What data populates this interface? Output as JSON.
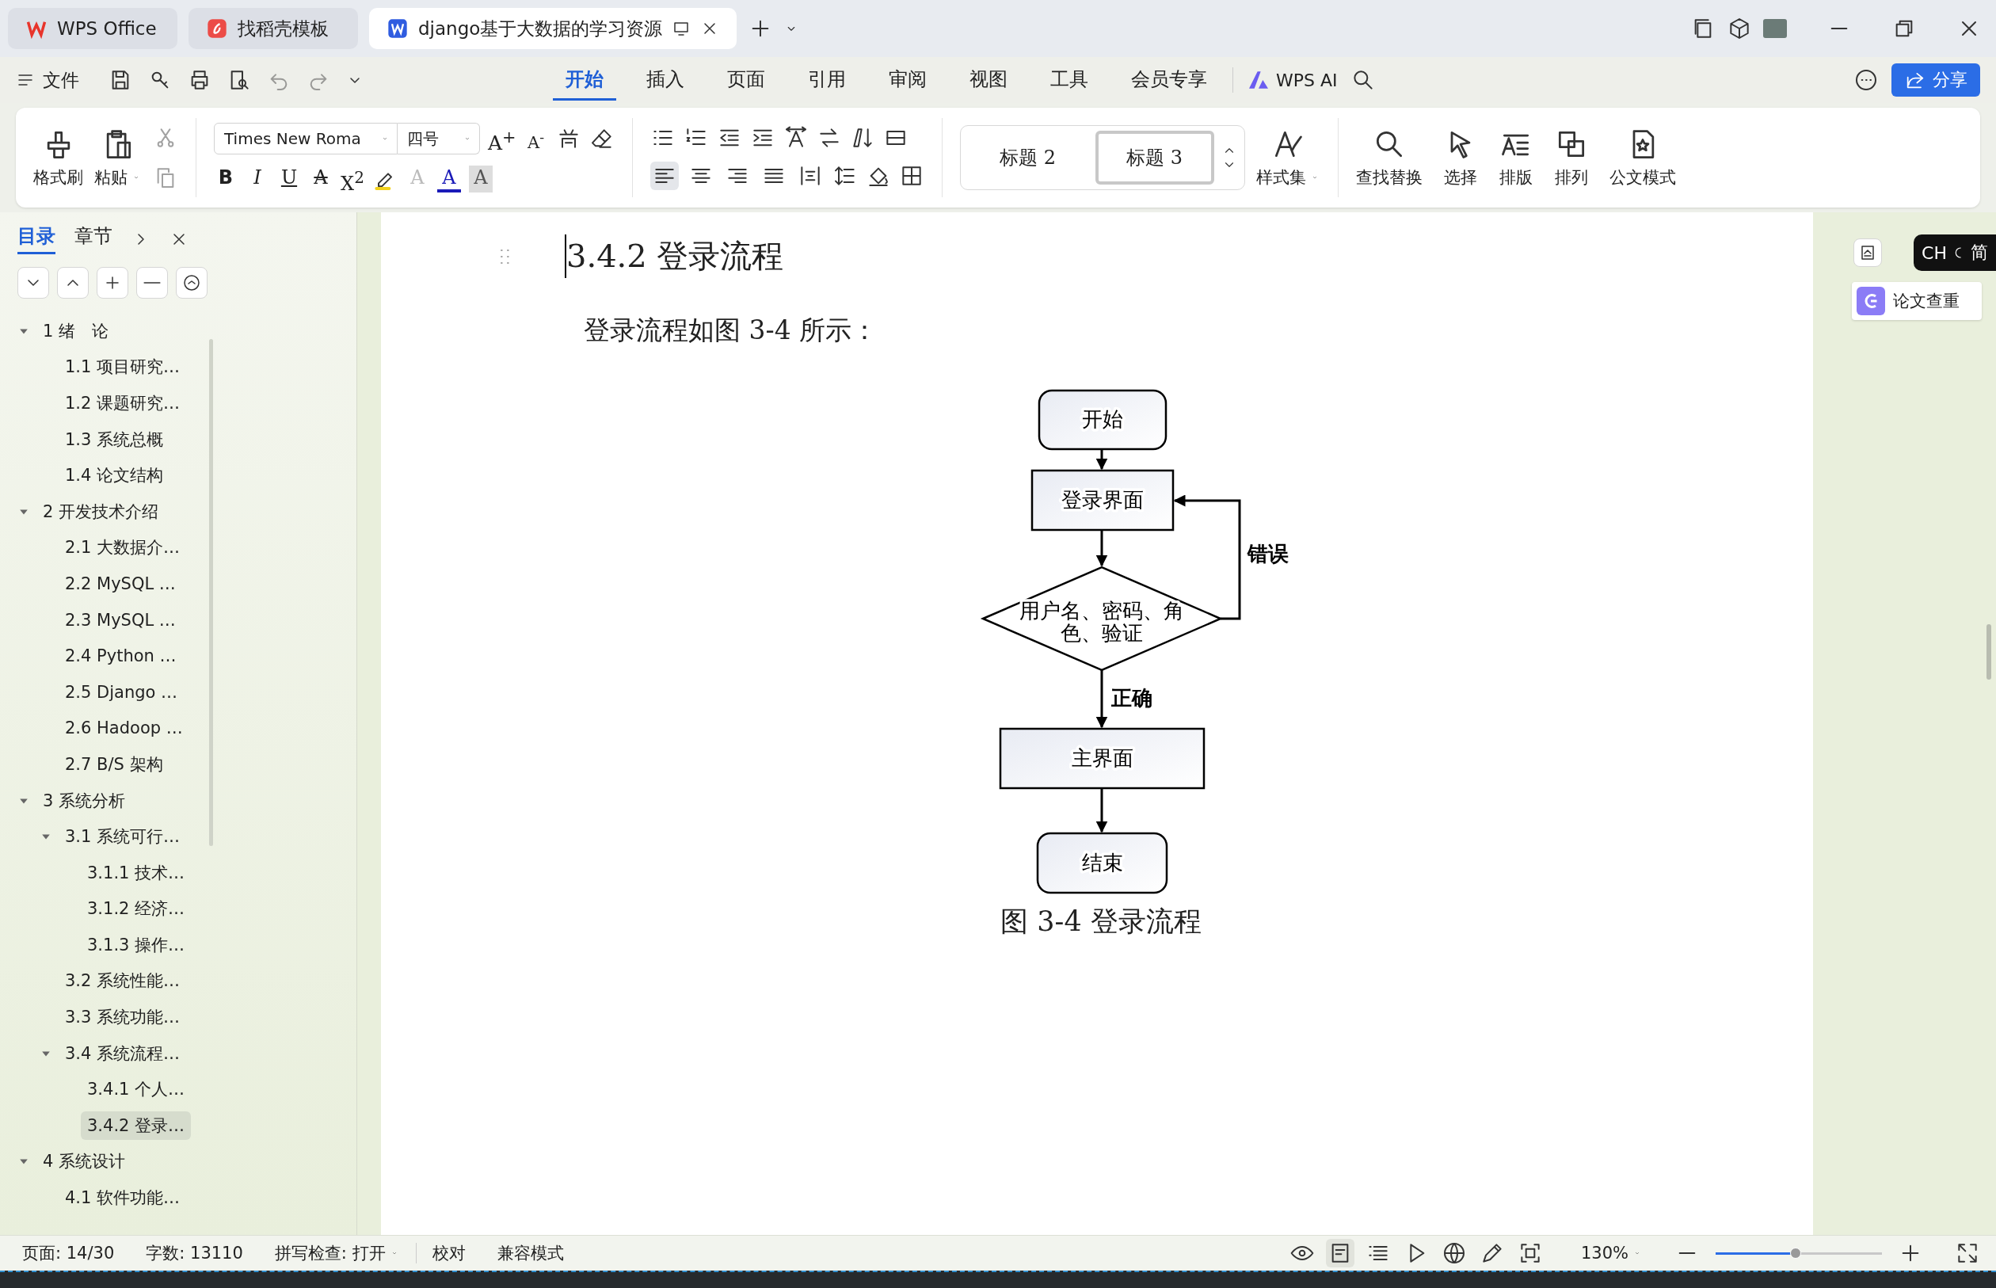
{
  "tabs": [
    {
      "label": "WPS Office",
      "kind": "home",
      "selected": false
    },
    {
      "label": "找稻壳模板",
      "kind": "template",
      "selected": false
    },
    {
      "label": "django基于大数据的学习资源",
      "kind": "document",
      "selected": true
    }
  ],
  "menu": {
    "file": "文件",
    "tabs": [
      {
        "label": "开始",
        "selected": true
      },
      {
        "label": "插入",
        "selected": false
      },
      {
        "label": "页面",
        "selected": false
      },
      {
        "label": "引用",
        "selected": false
      },
      {
        "label": "审阅",
        "selected": false
      },
      {
        "label": "视图",
        "selected": false
      },
      {
        "label": "工具",
        "selected": false
      },
      {
        "label": "会员专享",
        "selected": false
      }
    ],
    "ai": "WPS AI",
    "share": "分享"
  },
  "ribbon": {
    "format_painter": "格式刷",
    "paste": "粘贴",
    "font": "Times New Roma",
    "size": "四号",
    "glyphs_top": [
      {
        "kind": "grow",
        "glyph": "A$^{+}$"
      },
      {
        "kind": "shrink",
        "glyph": "A$^{-}$"
      }
    ],
    "glyphs_bottom": [
      {
        "kind": "bold",
        "glyph": "B"
      },
      {
        "kind": "italic",
        "glyph": "I"
      },
      {
        "kind": "underline",
        "glyph": "U"
      },
      {
        "kind": "strike",
        "glyph": "A"
      },
      {
        "kind": "superscript",
        "glyph": "X$^{2}$"
      },
      {
        "kind": "effect",
        "glyph": "A"
      },
      {
        "kind": "color",
        "glyph": "A",
        "color": "#1a1ab8"
      },
      {
        "kind": "shade",
        "glyph": "A"
      }
    ],
    "align": [
      {
        "kind": "left",
        "selected": true
      },
      {
        "kind": "center",
        "selected": false
      },
      {
        "kind": "right",
        "selected": false
      },
      {
        "kind": "justify",
        "selected": false
      },
      {
        "kind": "distributed",
        "selected": false
      }
    ],
    "styles": [
      {
        "label": "标题 2",
        "selected": false
      },
      {
        "label": "标题 3",
        "selected": true
      }
    ],
    "style_set": "样式集",
    "tools": [
      {
        "label": "查找替换",
        "kind": "search"
      },
      {
        "label": "选择",
        "kind": "select"
      },
      {
        "label": "排版",
        "kind": "layout"
      },
      {
        "label": "排列",
        "kind": "arrange"
      },
      {
        "label": "公文模式",
        "kind": "official"
      }
    ]
  },
  "sidebar": {
    "tabs": [
      {
        "label": "目录",
        "selected": true
      },
      {
        "label": "章节",
        "selected": false
      }
    ],
    "outline": [
      {
        "label": "1 绪　论",
        "selected": false,
        "expanded": true,
        "children": [
          {
            "label": "1.1 项目研究…",
            "selected": false
          },
          {
            "label": "1.2 课题研究…",
            "selected": false
          },
          {
            "label": "1.3 系统总概",
            "selected": false
          },
          {
            "label": "1.4 论文结构",
            "selected": false
          }
        ]
      },
      {
        "label": "2 开发技术介绍",
        "selected": false,
        "expanded": true,
        "children": [
          {
            "label": "2.1 大数据介…",
            "selected": false
          },
          {
            "label": "2.2 MySQL  …",
            "selected": false
          },
          {
            "label": "2.3 MySQL …",
            "selected": false
          },
          {
            "label": "2.4 Python …",
            "selected": false
          },
          {
            "label": "2.5 Django …",
            "selected": false
          },
          {
            "label": "2.6 Hadoop …",
            "selected": false
          },
          {
            "label": "2.7 B/S 架构",
            "selected": false
          }
        ]
      },
      {
        "label": "3 系统分析",
        "selected": false,
        "expanded": true,
        "children": [
          {
            "label": "3.1 系统可行…",
            "selected": false,
            "expanded": true,
            "children": [
              {
                "label": "3.1.1 技术…",
                "selected": false
              },
              {
                "label": "3.1.2 经济…",
                "selected": false
              },
              {
                "label": "3.1.3 操作…",
                "selected": false
              }
            ]
          },
          {
            "label": "3.2 系统性能…",
            "selected": false
          },
          {
            "label": "3.3 系统功能…",
            "selected": false
          },
          {
            "label": "3.4 系统流程…",
            "selected": false,
            "expanded": true,
            "children": [
              {
                "label": "3.4.1 个人…",
                "selected": false
              },
              {
                "label": "3.4.2 登录…",
                "selected": true
              }
            ]
          }
        ]
      },
      {
        "label": "4 系统设计",
        "selected": false,
        "expanded": true,
        "children": [
          {
            "label": "4.1 软件功能…",
            "selected": false
          }
        ]
      }
    ]
  },
  "document": {
    "heading": "3.4.2 登录流程",
    "paragraph": "登录流程如图 3-4 所示：",
    "flowchart": {
      "nodes": [
        {
          "kind": "terminal",
          "label": "开始"
        },
        {
          "kind": "process",
          "label": "登录界面"
        },
        {
          "kind": "decision",
          "label": "用户名、密码、角",
          "label_2": "色、验证"
        },
        {
          "kind": "process",
          "label": "主界面"
        },
        {
          "kind": "terminal",
          "label": "结束"
        }
      ],
      "edges": [
        {
          "kind": "loop",
          "label": "错误"
        },
        {
          "kind": "down",
          "label": "正确"
        }
      ]
    },
    "caption": "图 3-4 登录流程"
  },
  "side_panel": {
    "ime_lang": "CH",
    "ime_mode": "简",
    "check": "论文查重"
  },
  "status_bar": {
    "page": "页面: 14/30",
    "words": "字数: 13110",
    "spell": "拼写检查: 打开",
    "proof": "校对",
    "compat": "兼容模式",
    "views": [
      {
        "kind": "read",
        "selected": false
      },
      {
        "kind": "page",
        "selected": true
      },
      {
        "kind": "outline",
        "selected": false
      },
      {
        "kind": "play",
        "selected": false
      },
      {
        "kind": "web",
        "selected": false
      },
      {
        "kind": "pen",
        "selected": false
      },
      {
        "kind": "focus",
        "selected": false
      }
    ],
    "zoom": "130%",
    "zoom_slider": {
      "level": 0.48
    }
  }
}
